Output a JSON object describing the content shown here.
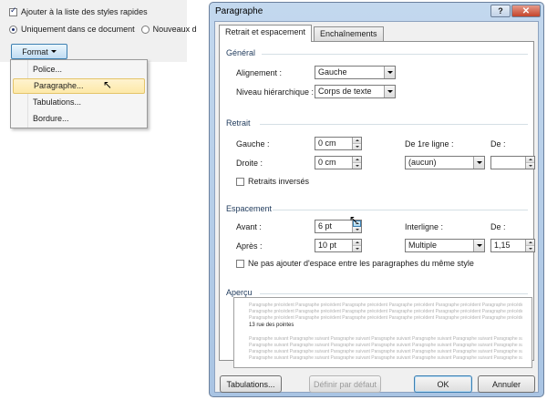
{
  "left_panel": {
    "checkbox_label": "Ajouter à la liste des styles rapides",
    "radio_current_label": "Uniquement dans ce document",
    "radio_new_label": "Nouveaux d",
    "format_button_label": "Format",
    "menu": {
      "police": "Police...",
      "paragraphe": "Paragraphe...",
      "tabulations": "Tabulations...",
      "bordure": "Bordure..."
    }
  },
  "dialog": {
    "title": "Paragraphe",
    "help_label": "?",
    "close_label": "✕",
    "tabs": {
      "active": "Retrait et espacement",
      "inactive": "Enchaînements"
    },
    "general": {
      "title": "Général",
      "alignment_label": "Alignement :",
      "alignment_value": "Gauche",
      "level_label": "Niveau hiérarchique :",
      "level_value": "Corps de texte"
    },
    "indent": {
      "title": "Retrait",
      "left_label": "Gauche :",
      "left_value": "0 cm",
      "right_label": "Droite :",
      "right_value": "0 cm",
      "first_line_label": "De 1re ligne :",
      "first_line_value": "(aucun)",
      "by_label": "De :",
      "by_value": "",
      "mirror_label": "Retraits inversés"
    },
    "spacing": {
      "title": "Espacement",
      "before_label": "Avant :",
      "before_value": "6 pt",
      "after_label": "Après :",
      "after_value": "10 pt",
      "line_label": "Interligne :",
      "line_value": "Multiple",
      "at_label": "De :",
      "at_value": "1,15",
      "no_space_label": "Ne pas ajouter d'espace entre les paragraphes du même style"
    },
    "preview": {
      "title": "Aperçu",
      "prev_text": "Paragraphe précédent Paragraphe précédent Paragraphe précédent Paragraphe précédent Paragraphe précédent Paragraphe précédent",
      "main_text": "13 rue des pointes",
      "next_text": "Paragraphe suivant Paragraphe suivant Paragraphe suivant Paragraphe suivant Paragraphe suivant Paragraphe suivant Paragraphe suivant"
    },
    "buttons": {
      "tabs": "Tabulations...",
      "default": "Définir par défaut",
      "ok": "OK",
      "cancel": "Annuler"
    }
  },
  "colors": {
    "accent": "#3c7fb1",
    "highlight": "#fde9a8",
    "close": "#c4442a"
  }
}
